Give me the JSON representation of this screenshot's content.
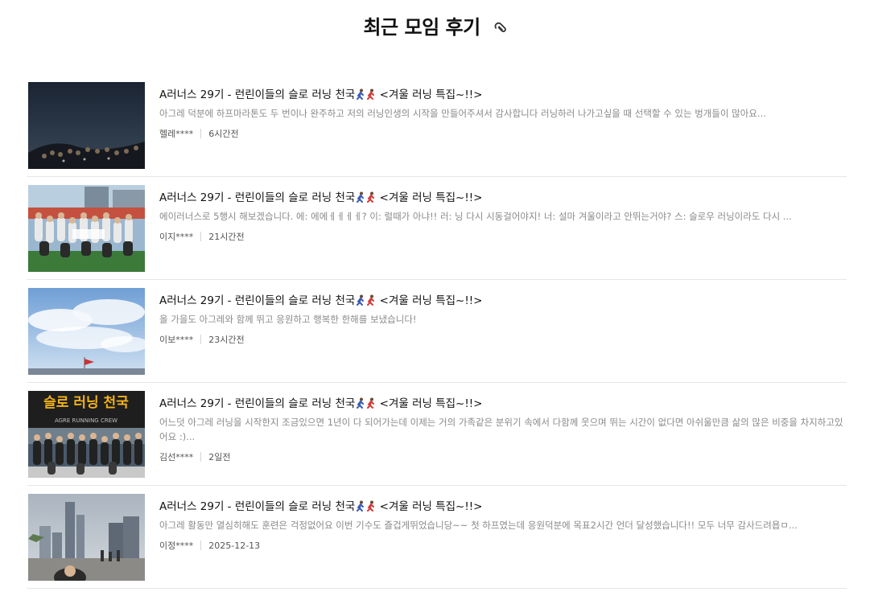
{
  "header": {
    "title": "최근 모임 후기",
    "icon": "paperclip-icon"
  },
  "posts": [
    {
      "title_main": "A러너스 29기 - 런린이들의 슬로 러닝 천국",
      "title_tail": " <겨울 러닝 특집~!!>",
      "description": "아그레 덕분에 하프마라톤도 두 번이나 완주하고 저의 러닝인생의 시작을 만들어주셔서 감사합니다 러닝하러 나가고싶을 때 선택할 수 있는 벙개들이 많아요...",
      "author": "헬레****",
      "time": "6시간전"
    },
    {
      "title_main": "A러너스 29기 - 런린이들의 슬로 러닝 천국",
      "title_tail": " <겨울 러닝 특집~!!>",
      "description": "에이러너스로 5행시 해보겠습니다. 에: 에에ㅔㅔㅔㅔ? 이: 럴때가 아냐!! 러: 닝 다시 시동걸어야지! 너: 설마 겨울이라고 안뛰는거야? 스: 슬로우 러닝이라도 다시 ...",
      "author": "이지****",
      "time": "21시간전"
    },
    {
      "title_main": "A러너스 29기 - 런린이들의 슬로 러닝 천국",
      "title_tail": " <겨울 러닝 특집~!!>",
      "description": "올 가을도 아그레와 함께 뛰고 응원하고 행복한 한해를 보냈습니다!",
      "author": "이보****",
      "time": "23시간전"
    },
    {
      "title_main": "A러너스 29기 - 런린이들의 슬로 러닝 천국",
      "title_tail": " <겨울 러닝 특집~!!>",
      "description": "어느덧 아그레 러닝을 시작한지 조금있으면 1년이 다 되어가는데 이제는 거의 가족같은 분위기 속에서 다함께 웃으며 뛰는 시간이 없다면 아쉬울만큼 삶의 많은 비중을 차지하고있어요 :)...",
      "author": "김선****",
      "time": "2일전",
      "thumb_text": "슬로 러닝 천국",
      "thumb_subtext": "AGRE RUNNING CREW"
    },
    {
      "title_main": "A러너스 29기 - 런린이들의 슬로 러닝 천국",
      "title_tail": " <겨울 러닝 특집~!!>",
      "description": "아그레 활동만 열심히해도 훈련은 걱정없어요 이번 기수도 즐겁게뛰었습니당~~ 첫 하프였는데 응원덕분에 목표2시간 언더 달성했습니다!! 모두 너무 감사드려욥ㅁ...",
      "author": "이정****",
      "time": "2025-12-13"
    }
  ]
}
